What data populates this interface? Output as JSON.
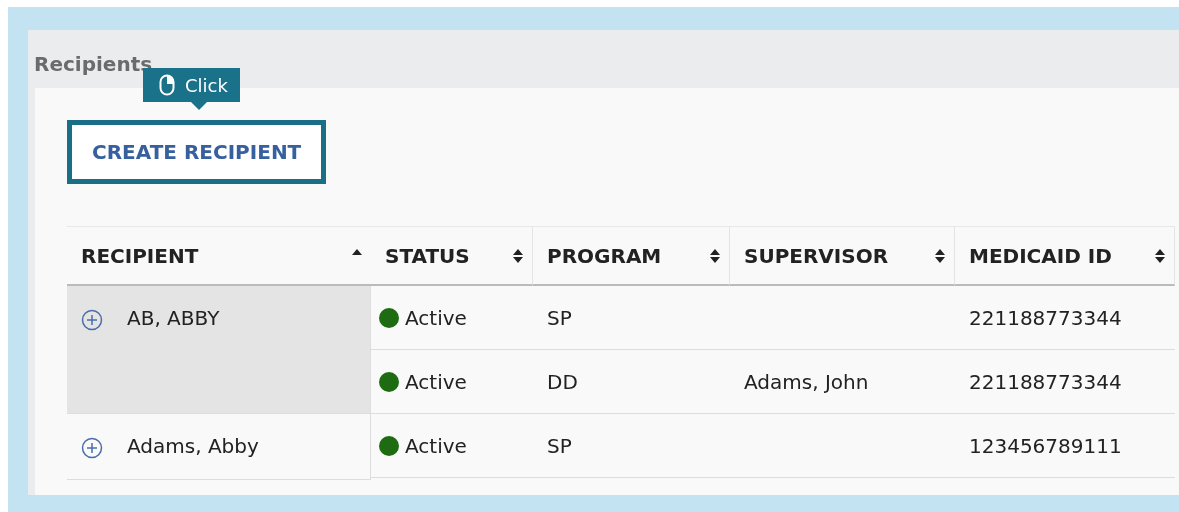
{
  "page_title": "Recipients",
  "tooltip": {
    "label": "Click"
  },
  "create_button": {
    "label": "CREATE RECIPIENT",
    "highlighted": true
  },
  "table": {
    "columns": [
      {
        "label": "RECIPIENT",
        "sorted": true
      },
      {
        "label": "STATUS",
        "sorted": false
      },
      {
        "label": "PROGRAM",
        "sorted": false
      },
      {
        "label": "SUPERVISOR",
        "sorted": false
      },
      {
        "label": "MEDICAID ID",
        "sorted": false
      }
    ],
    "rows": [
      {
        "name": "AB, ABBY",
        "highlighted": true,
        "programs": [
          {
            "status": "Active",
            "color": "#1e6b12",
            "program": "SP",
            "medicaid_id": "221188773344"
          },
          {
            "status": "Active",
            "color": "#1e6b12",
            "program": "DD",
            "supervisor": "Adams, John",
            "medicaid_id": "221188773344"
          }
        ]
      },
      {
        "name": "Adams, Abby",
        "highlighted": false,
        "programs": [
          {
            "status": "Active",
            "color": "#1e6b12",
            "program": "SP",
            "medicaid_id": "123456789111"
          }
        ]
      }
    ]
  }
}
